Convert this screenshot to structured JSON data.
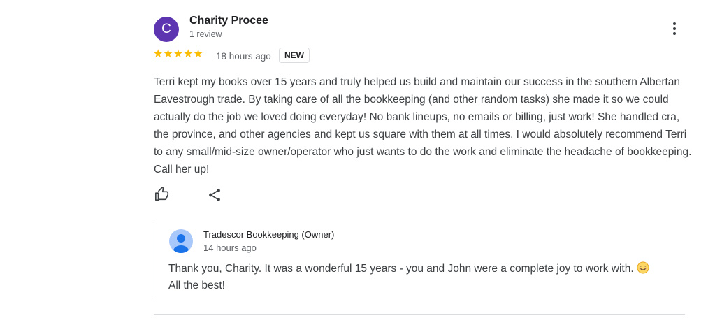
{
  "review": {
    "author": {
      "initial": "C",
      "name": "Charity Procee",
      "review_count": "1 review",
      "avatar_color": "#5e35b1"
    },
    "rating": 5,
    "stars": "★★★★★",
    "star_color": "#fbbc04",
    "time": "18 hours ago",
    "badge": "NEW",
    "text": "Terri kept my books over 15 years and truly helped us build and maintain our success in the southern Albertan Eavestrough trade. By taking care of all the bookkeeping (and other random tasks) she made it so we could actually do the job we loved doing everyday! No bank lineups, no emails or billing, just work! She handled cra, the province, and other agencies and kept us square with them at all times. I would absolutely recommend Terri to any small/mid-size owner/operator who just wants to do the work and eliminate the headache of bookkeeping. Call her up!",
    "actions": {
      "like_icon": "thumbs-up-icon",
      "share_icon": "share-icon"
    }
  },
  "owner_reply": {
    "name": "Tradescor Bookkeeping (Owner)",
    "time": "14 hours ago",
    "text_before_emoji": "Thank you, Charity. It was a wonderful 15 years - you and John were a complete joy to work with. ",
    "emoji_icon": "smiling-face-icon",
    "text_after_emoji": "All the best!"
  }
}
